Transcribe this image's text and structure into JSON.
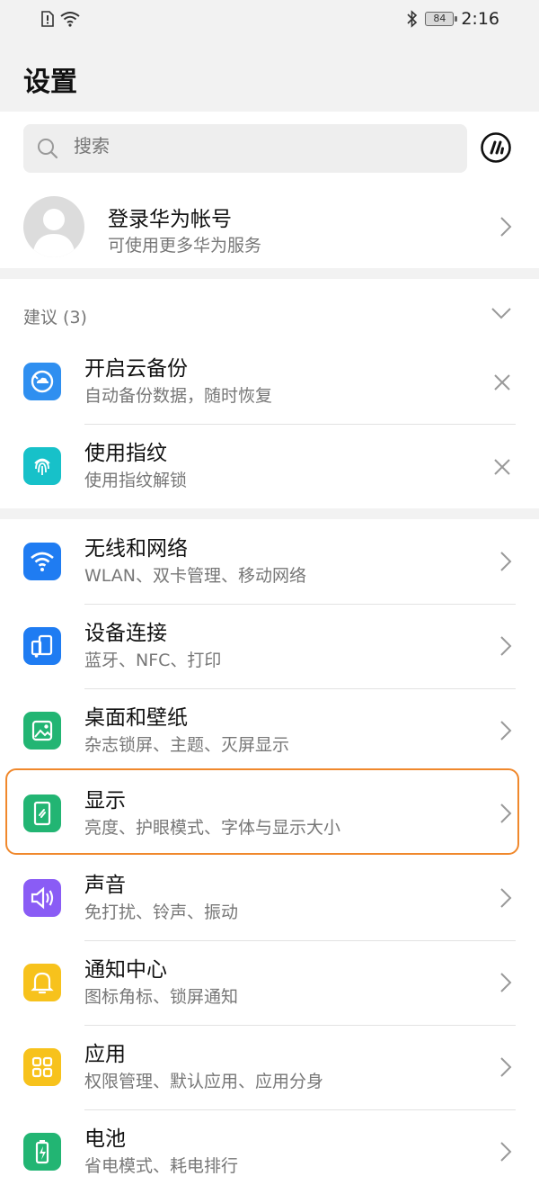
{
  "status": {
    "battery": "84",
    "time": "2:16"
  },
  "header": {
    "title": "设置"
  },
  "search": {
    "placeholder": "搜索"
  },
  "account": {
    "title": "登录华为帐号",
    "subtitle": "可使用更多华为服务"
  },
  "suggestions": {
    "heading": "建议 (3)",
    "items": [
      {
        "title": "开启云备份",
        "subtitle": "自动备份数据，随时恢复",
        "icon": "cloud-backup-icon",
        "color": "#2f8ff0"
      },
      {
        "title": "使用指纹",
        "subtitle": "使用指纹解锁",
        "icon": "fingerprint-icon",
        "color": "#17c1c9"
      }
    ]
  },
  "settings": [
    {
      "title": "无线和网络",
      "subtitle": "WLAN、双卡管理、移动网络",
      "icon": "wifi-icon",
      "color": "#1f7cf2"
    },
    {
      "title": "设备连接",
      "subtitle": "蓝牙、NFC、打印",
      "icon": "device-connection-icon",
      "color": "#1f7cf2"
    },
    {
      "title": "桌面和壁纸",
      "subtitle": "杂志锁屏、主题、灭屏显示",
      "icon": "wallpaper-icon",
      "color": "#22b573"
    },
    {
      "title": "显示",
      "subtitle": "亮度、护眼模式、字体与显示大小",
      "icon": "display-icon",
      "color": "#22b573"
    },
    {
      "title": "声音",
      "subtitle": "免打扰、铃声、振动",
      "icon": "sound-icon",
      "color": "#8a5cf5"
    },
    {
      "title": "通知中心",
      "subtitle": "图标角标、锁屏通知",
      "icon": "notification-icon",
      "color": "#f7c21c"
    },
    {
      "title": "应用",
      "subtitle": "权限管理、默认应用、应用分身",
      "icon": "apps-icon",
      "color": "#f7c21c"
    },
    {
      "title": "电池",
      "subtitle": "省电模式、耗电排行",
      "icon": "battery-icon",
      "color": "#22b573"
    }
  ],
  "highlight_color": "#f0882c"
}
